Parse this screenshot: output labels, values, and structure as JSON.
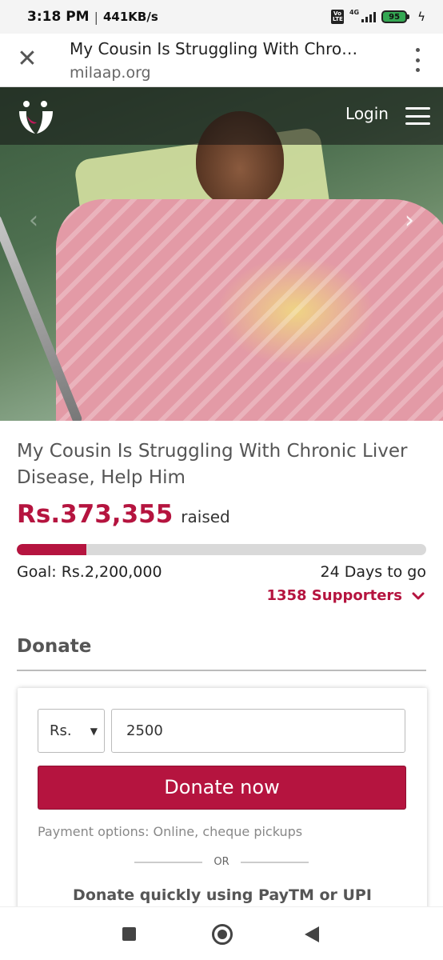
{
  "status_bar": {
    "time": "3:18 PM",
    "separator": "|",
    "speed": "441KB/s",
    "volte": "Vo LTE",
    "network": "4G",
    "battery": "95"
  },
  "browser": {
    "title": "My Cousin Is Struggling With Chro…",
    "url": "milaap.org",
    "close_icon": "close-icon",
    "menu_icon": "more-vert-icon"
  },
  "site_nav": {
    "login_label": "Login",
    "logo_icon": "milaap-logo-icon",
    "menu_icon": "hamburger-icon"
  },
  "hero": {
    "next_icon": "chevron-right-icon",
    "prev_icon": "chevron-left-icon"
  },
  "campaign": {
    "title": "My Cousin Is Struggling With Chronic Liver Disease, Help Him",
    "raised_amount": "Rs.373,355",
    "raised_label": "raised",
    "progress_fraction": 0.17,
    "goal_text": "Goal: Rs.2,200,000",
    "days_left": "24 Days to go",
    "supporters": "1358 Supporters"
  },
  "donate": {
    "heading": "Donate",
    "currency": "Rs.",
    "amount": "2500",
    "button_label": "Donate now",
    "payment_options": "Payment options: Online, cheque pickups",
    "or_label": "OR",
    "quick_donate": "Donate quickly using PayTM or UPI"
  },
  "colors": {
    "accent": "#b5143f",
    "progress_track": "#d9d9d9"
  }
}
